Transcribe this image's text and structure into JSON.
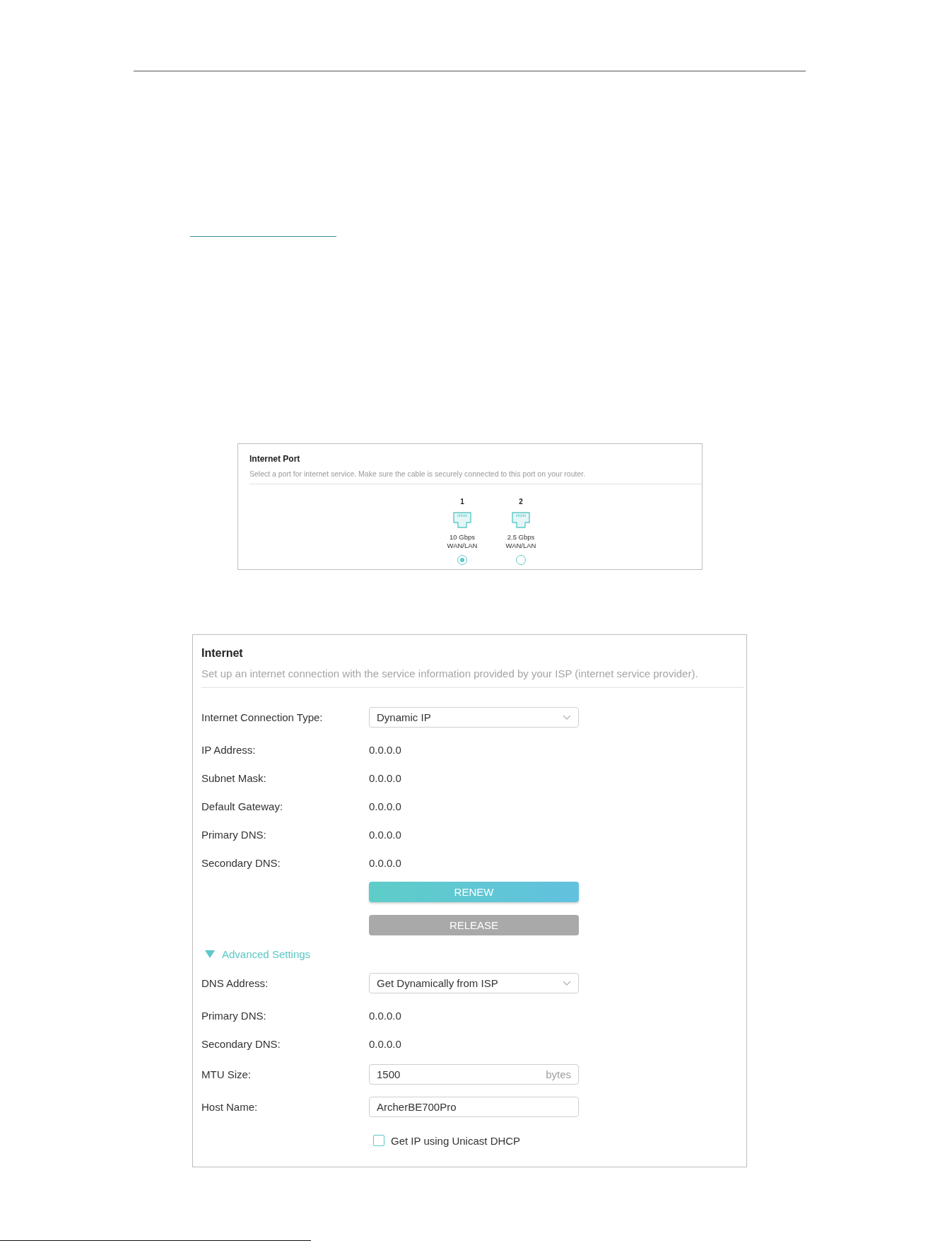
{
  "internet_port": {
    "title": "Internet Port",
    "description": "Select a port for internet service. Make sure the cable is securely connected to this port on your router.",
    "ports": [
      {
        "number": "1",
        "speed": "10 Gbps",
        "type": "WAN/LAN",
        "selected": true
      },
      {
        "number": "2",
        "speed": "2.5 Gbps",
        "type": "WAN/LAN",
        "selected": false
      }
    ]
  },
  "internet": {
    "title": "Internet",
    "description": "Set up an internet connection with the service information provided by your ISP (internet service provider).",
    "fields": [
      {
        "kind": "select",
        "label": "Internet Connection Type:",
        "value": "Dynamic IP"
      },
      {
        "kind": "value",
        "label": "IP Address:",
        "value": "0.0.0.0"
      },
      {
        "kind": "value",
        "label": "Subnet Mask:",
        "value": "0.0.0.0"
      },
      {
        "kind": "value",
        "label": "Default Gateway:",
        "value": "0.0.0.0"
      },
      {
        "kind": "value",
        "label": "Primary DNS:",
        "value": "0.0.0.0"
      },
      {
        "kind": "value",
        "label": "Secondary DNS:",
        "value": "0.0.0.0"
      }
    ],
    "buttons": [
      {
        "label": "RENEW",
        "disabled": false
      },
      {
        "label": "RELEASE",
        "disabled": true
      }
    ],
    "advanced": {
      "label": "Advanced Settings",
      "expanded": true
    },
    "advanced_fields": [
      {
        "kind": "select",
        "label": "DNS Address:",
        "value": "Get Dynamically from ISP"
      },
      {
        "kind": "value",
        "label": "Primary DNS:",
        "value": "0.0.0.0"
      },
      {
        "kind": "value",
        "label": "Secondary DNS:",
        "value": "0.0.0.0"
      },
      {
        "kind": "input",
        "label": "MTU Size:",
        "value": "1500",
        "unit": "bytes"
      },
      {
        "kind": "input",
        "label": "Host Name:",
        "value": "ArcherBE700Pro"
      }
    ],
    "unicast_dhcp": {
      "label": "Get IP using Unicast DHCP",
      "checked": false
    }
  }
}
